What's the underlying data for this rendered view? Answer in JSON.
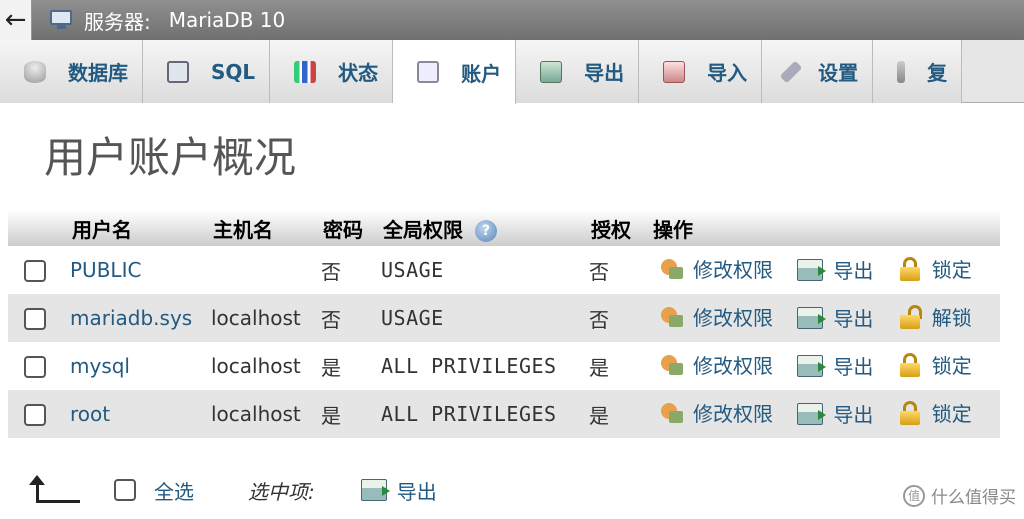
{
  "topbar": {
    "back_icon": "←",
    "server_label": "服务器:",
    "server_name": "MariaDB 10"
  },
  "tabs": [
    {
      "label": "数据库",
      "icon": "database-icon"
    },
    {
      "label": "SQL",
      "icon": "sql-icon"
    },
    {
      "label": "状态",
      "icon": "status-icon"
    },
    {
      "label": "账户",
      "icon": "account-icon",
      "active": true
    },
    {
      "label": "导出",
      "icon": "export-icon"
    },
    {
      "label": "导入",
      "icon": "import-icon"
    },
    {
      "label": "设置",
      "icon": "settings-icon"
    },
    {
      "label": "复",
      "icon": "replication-icon"
    }
  ],
  "page_title": "用户账户概况",
  "table": {
    "headers": {
      "username": "用户名",
      "host": "主机名",
      "password": "密码",
      "global_privileges": "全局权限",
      "grant": "授权",
      "actions": "操作"
    },
    "help_icon": "?",
    "rows": [
      {
        "username": "PUBLIC",
        "host": "",
        "password": "否",
        "privileges": "USAGE",
        "grant": "否",
        "edit": "修改权限",
        "export": "导出",
        "lock": "锁定"
      },
      {
        "username": "mariadb.sys",
        "host": "localhost",
        "password": "否",
        "privileges": "USAGE",
        "grant": "否",
        "edit": "修改权限",
        "export": "导出",
        "lock": "解锁"
      },
      {
        "username": "mysql",
        "host": "localhost",
        "password": "是",
        "privileges": "ALL PRIVILEGES",
        "grant": "是",
        "edit": "修改权限",
        "export": "导出",
        "lock": "锁定"
      },
      {
        "username": "root",
        "host": "localhost",
        "password": "是",
        "privileges": "ALL PRIVILEGES",
        "grant": "是",
        "edit": "修改权限",
        "export": "导出",
        "lock": "锁定"
      }
    ]
  },
  "footer": {
    "select_all": "全选",
    "with_selected": "选中项:",
    "export": "导出"
  },
  "watermark": {
    "icon": "值",
    "text": "什么值得买"
  }
}
